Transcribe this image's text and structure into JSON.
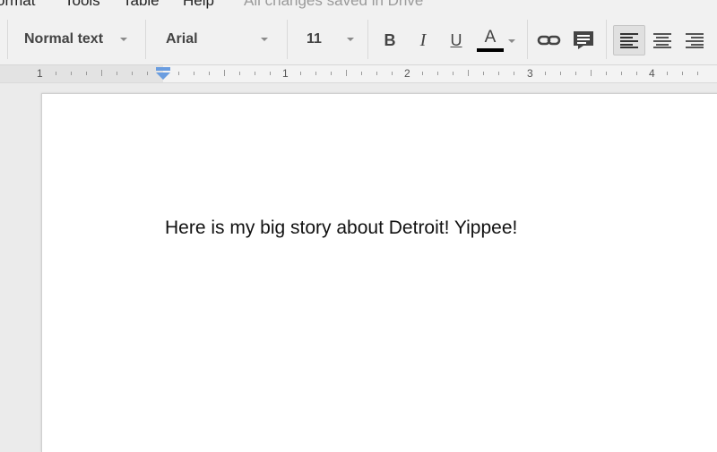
{
  "menu": {
    "items": [
      "ormat",
      "Tools",
      "Table",
      "Help"
    ],
    "save_status": "All changes saved in Drive"
  },
  "toolbar": {
    "style_value": "Normal text",
    "font_value": "Arial",
    "size_value": "11",
    "bold_label": "B",
    "italic_label": "I",
    "underline_label": "U",
    "text_color_label": "A",
    "text_color": "#000000"
  },
  "ruler": {
    "labels": [
      "1",
      "1",
      "2",
      "3",
      "4"
    ]
  },
  "document": {
    "body_text": "Here is my big story about Detroit! Yippee!"
  },
  "icons": [
    "caret-down-icon",
    "link-icon",
    "comment-icon",
    "align-left-icon",
    "align-center-icon",
    "align-right-icon",
    "indent-marker-icon"
  ]
}
